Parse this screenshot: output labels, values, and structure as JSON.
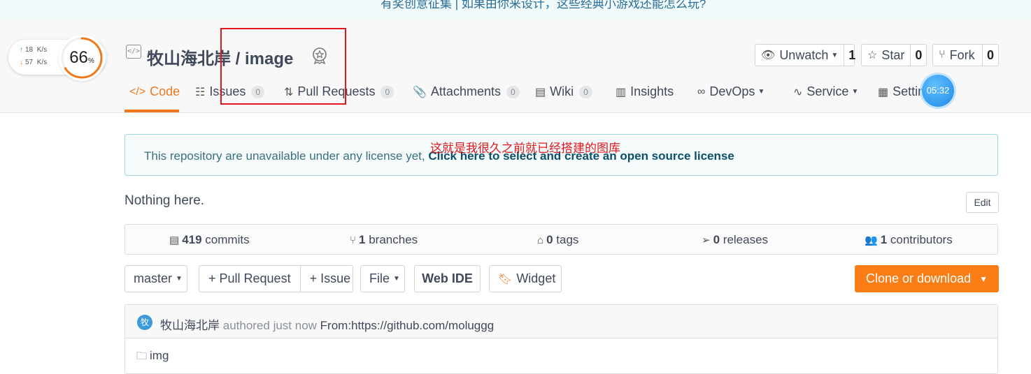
{
  "banner": {
    "text": "有奖创意征集 | 如果由你来设计，这些经典小游戏还能怎么玩?"
  },
  "network": {
    "upload": "18",
    "download": "57",
    "unit": "K/s",
    "cpu_percent": "66",
    "percent_sign": "%",
    "cpu_fraction": 0.66
  },
  "repo": {
    "owner": "牧山海北岸",
    "separator": "/",
    "name": "image",
    "type_icon": "code-bracket-icon",
    "badge_icon": "award-badge-icon"
  },
  "actions": {
    "watch": {
      "label": "Unwatch",
      "count": "1"
    },
    "star": {
      "label": "Star",
      "count": "0"
    },
    "fork": {
      "label": "Fork",
      "count": "0"
    }
  },
  "tabs": [
    {
      "label": "Code"
    },
    {
      "label": "Issues",
      "count": "0"
    },
    {
      "label": "Pull Requests",
      "count": "0"
    },
    {
      "label": "Attachments",
      "count": "0"
    },
    {
      "label": "Wiki",
      "count": "0"
    },
    {
      "label": "Insights"
    },
    {
      "label": "DevOps"
    },
    {
      "label": "Service"
    },
    {
      "label": "Settin"
    }
  ],
  "clock": {
    "time": "05:32"
  },
  "notice": {
    "text": "This repository are unavailable under any license yet, ",
    "link": "Click here to select and create an open source license"
  },
  "annotation": {
    "text": "这就是我很久之前就已经搭建的图库"
  },
  "readme": {
    "text": "Nothing here.",
    "edit_label": "Edit"
  },
  "stats": {
    "commits": {
      "count": "419",
      "label": "commits"
    },
    "branches": {
      "count": "1",
      "label": "branches"
    },
    "tags": {
      "count": "0",
      "label": "tags"
    },
    "releases": {
      "count": "0",
      "label": "releases"
    },
    "contributors": {
      "count": "1",
      "label": "contributors"
    }
  },
  "toolbar": {
    "branch": "master",
    "pull_request": "+ Pull Request",
    "issue": "+ Issue",
    "file": "File",
    "web_ide": "Web IDE",
    "widget": "Widget",
    "clone": "Clone or download"
  },
  "commit": {
    "avatar_char": "牧",
    "author": "牧山海北岸",
    "time": "authored just now",
    "message": "From:https://github.com/moluggg"
  },
  "files": [
    {
      "name": "img"
    }
  ],
  "colors": {
    "accent": "#f0771c",
    "clone_button": "#fa7d16",
    "annotation_red": "#e0171d",
    "notice_link": "#0c4f6b"
  }
}
